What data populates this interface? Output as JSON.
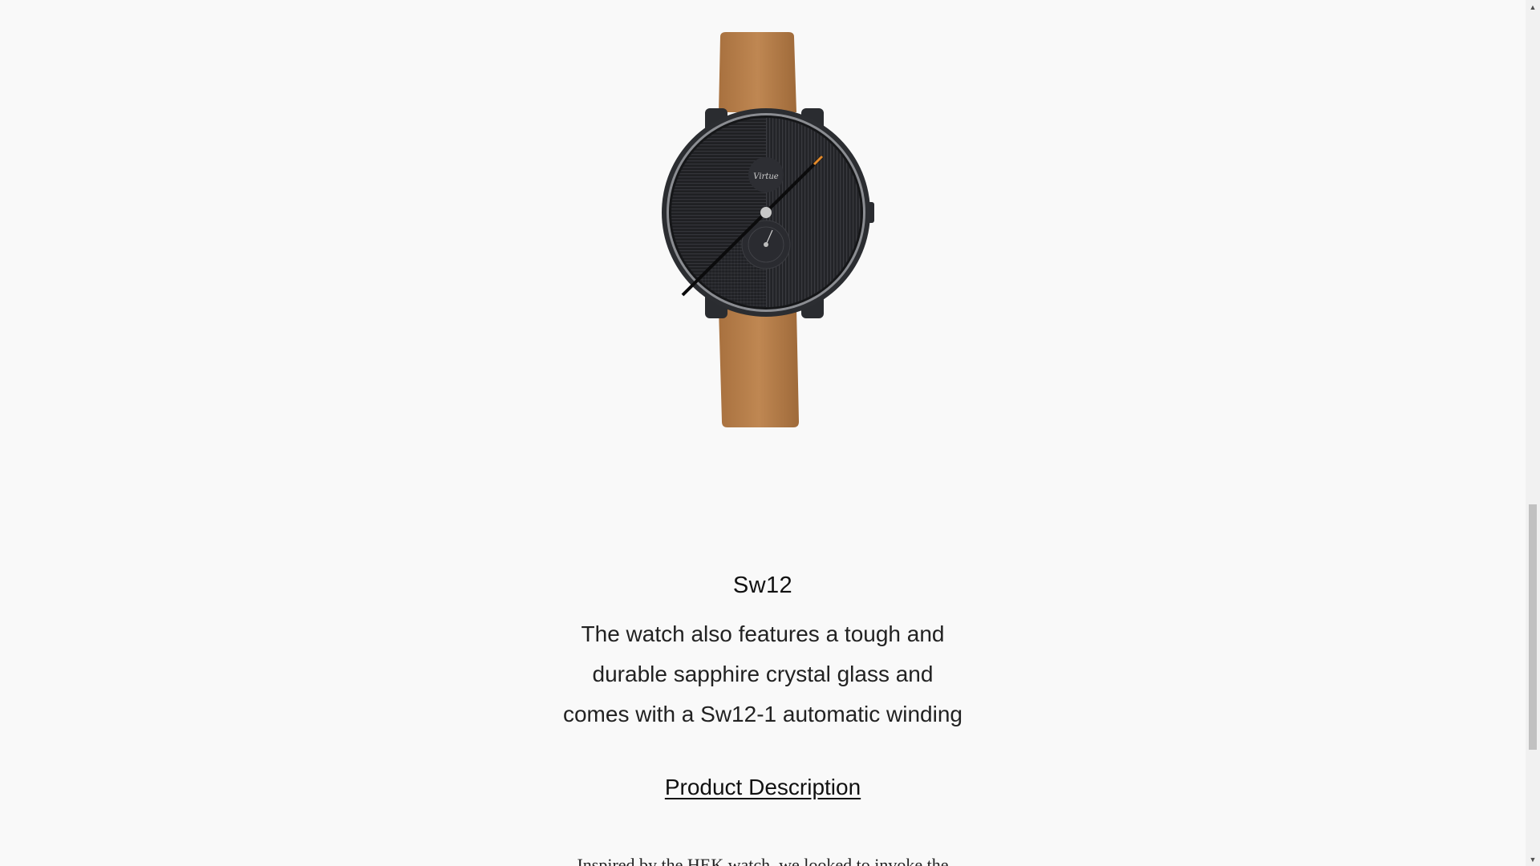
{
  "product": {
    "name": "Sw12",
    "dial_brand": "Virtue",
    "description_lines": [
      "The watch also features a tough and",
      "durable sapphire crystal glass and",
      "comes with a Sw12-1 automatic winding"
    ],
    "description_link": "Product Description",
    "next_text_partial": "Inspired by the HEK watch, we looked to invoke the"
  },
  "colors": {
    "background": "#f9f9f9",
    "strap": "#b07a47",
    "case": "#2b2d31",
    "dial": "#1e1f22",
    "accent": "#e38b2c"
  },
  "icons": {
    "scroll_up": "scroll-up-arrow-icon",
    "scroll_down": "scroll-down-arrow-icon"
  },
  "scrollbar": {
    "up_glyph": "▲",
    "down_glyph": "▼"
  }
}
